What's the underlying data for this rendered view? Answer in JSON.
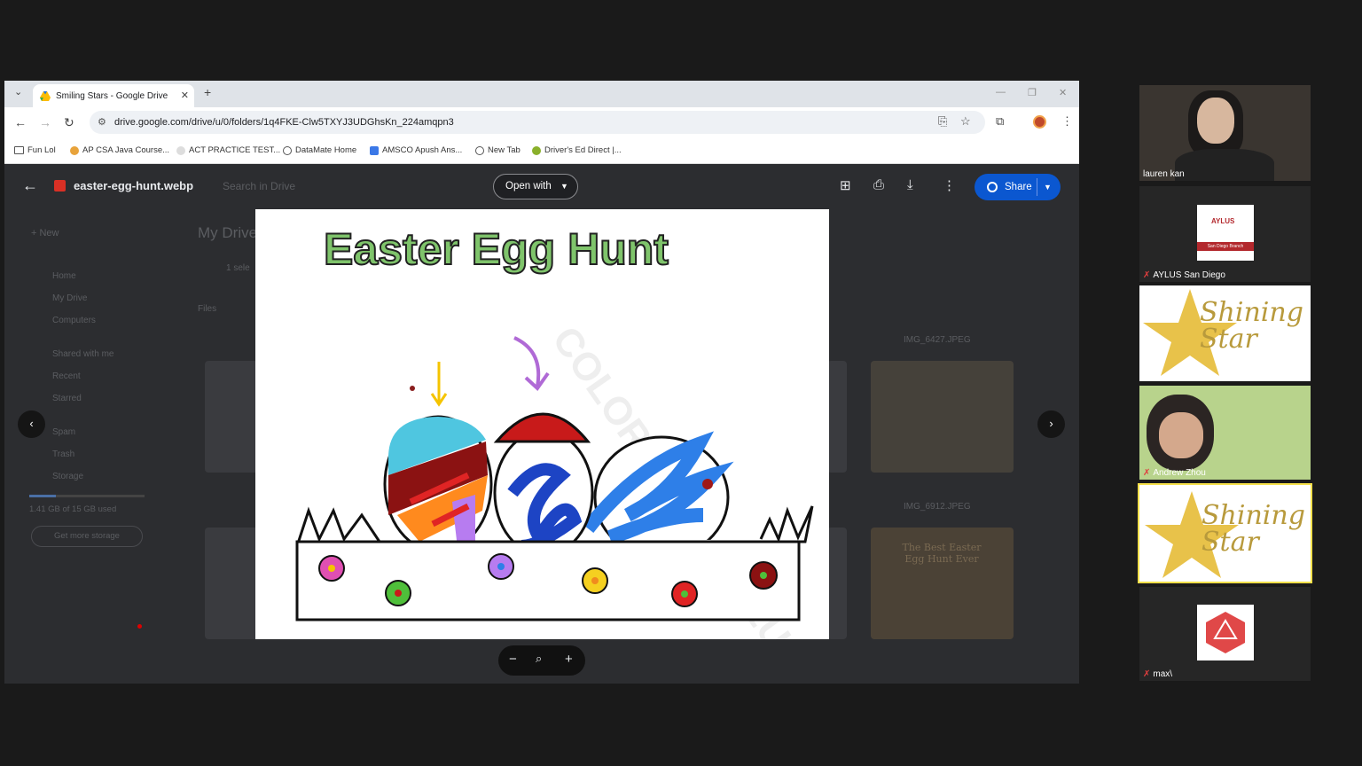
{
  "browser": {
    "tab_title": "Smiling Stars - Google Drive",
    "url": "drive.google.com/drive/u/0/folders/1q4FKE-Clw5TXYJ3UDGhsKn_224amqpn3",
    "bookmarks": [
      "Fun Lol",
      "AP CSA Java Course...",
      "ACT PRACTICE TEST...",
      "DataMate Home",
      "AMSCO Apush Ans...",
      "New Tab",
      "Driver's Ed Direct |..."
    ]
  },
  "viewer": {
    "file_name": "easter-egg-hunt.webp",
    "open_with": "Open with",
    "share": "Share",
    "image_title": "Easter Egg Hunt",
    "watermark": "COLORINGPAGE.EU"
  },
  "drive_bg": {
    "search_placeholder": "Search in Drive",
    "new": "New",
    "nav": [
      "Home",
      "My Drive",
      "Computers",
      "Shared with me",
      "Recent",
      "Starred",
      "Spam",
      "Trash",
      "Storage"
    ],
    "storage_used": "1.41 GB of 15 GB used",
    "get_storage": "Get more storage",
    "title": "My Drive",
    "selected": "1 sele",
    "files_label": "Files",
    "file1": "IMG_6427.JPEG",
    "file2": "IMG_6912.JPEG",
    "card_title": "The Best Easter Egg Hunt Ever"
  },
  "participants": [
    {
      "name": "lauren kan",
      "muted": false
    },
    {
      "name": "AYLUS San Diego",
      "muted": true,
      "logo_text": "AYLUS",
      "logo_sub": "San Diego Branch"
    },
    {
      "name": "",
      "muted": false,
      "logo_text": "Shining Star"
    },
    {
      "name": "Andrew Zhou",
      "muted": true
    },
    {
      "name": "",
      "muted": false,
      "logo_text": "Shining Star"
    },
    {
      "name": "max\\",
      "muted": true
    }
  ]
}
